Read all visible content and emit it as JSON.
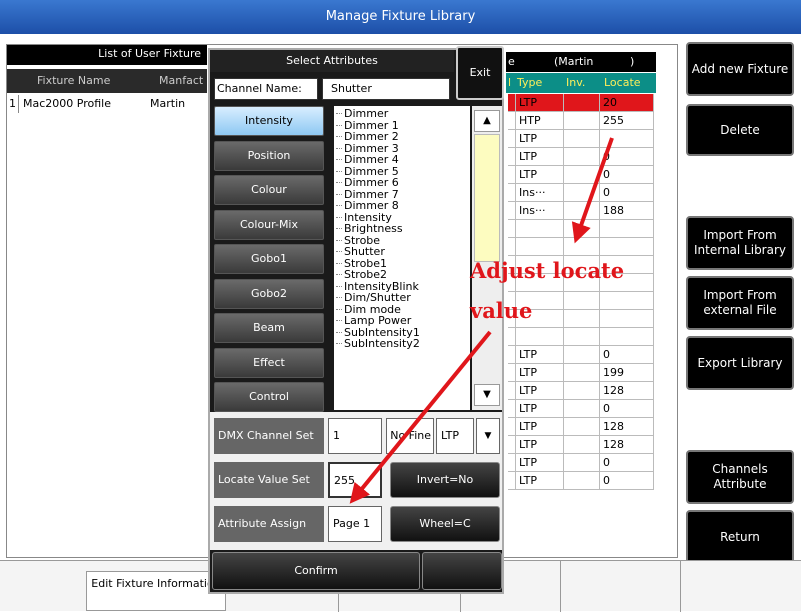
{
  "window": {
    "title": "Manage Fixture Library"
  },
  "left_panel": {
    "header": "List of User Fixture",
    "columns": [
      "Fixture Name",
      "Manfact"
    ],
    "rows": [
      {
        "index": "1",
        "name": "Mac2000 Profile",
        "manufacturer": "Martin"
      }
    ]
  },
  "channel_table": {
    "header_suffix": "e",
    "header_maker": "(Martin",
    "header_close": ")",
    "columns": [
      "l",
      "Type",
      "Inv.",
      "Locate"
    ],
    "rows": [
      {
        "type": "LTP",
        "inv": "",
        "locate": "20",
        "highlight": true
      },
      {
        "type": "HTP",
        "inv": "",
        "locate": "255"
      },
      {
        "type": "LTP",
        "inv": "",
        "locate": ""
      },
      {
        "type": "LTP",
        "inv": "",
        "locate": "0"
      },
      {
        "type": "LTP",
        "inv": "",
        "locate": "0"
      },
      {
        "type": "Ins···",
        "inv": "",
        "locate": "0"
      },
      {
        "type": "Ins···",
        "inv": "",
        "locate": "188"
      },
      {
        "type": "",
        "inv": "",
        "locate": ""
      },
      {
        "type": "",
        "inv": "",
        "locate": ""
      },
      {
        "type": "",
        "inv": "",
        "locate": ""
      },
      {
        "type": "",
        "inv": "",
        "locate": ""
      },
      {
        "type": "",
        "inv": "",
        "locate": ""
      },
      {
        "type": "",
        "inv": "",
        "locate": ""
      },
      {
        "type": "",
        "inv": "",
        "locate": ""
      },
      {
        "type": "LTP",
        "inv": "",
        "locate": "0"
      },
      {
        "type": "LTP",
        "inv": "",
        "locate": "199"
      },
      {
        "type": "LTP",
        "inv": "",
        "locate": "128"
      },
      {
        "type": "LTP",
        "inv": "",
        "locate": "0"
      },
      {
        "type": "LTP",
        "inv": "",
        "locate": "128"
      },
      {
        "type": "LTP",
        "inv": "",
        "locate": "128"
      },
      {
        "type": "LTP",
        "inv": "",
        "locate": "0"
      },
      {
        "type": "LTP",
        "inv": "",
        "locate": "0"
      }
    ]
  },
  "right_buttons": {
    "add_new": "Add new Fixture",
    "delete": "Delete",
    "import_internal": "Import From Internal Library",
    "import_external": "Import From external File",
    "export": "Export Library",
    "channels_attr": "Channels Attribute",
    "return": "Return"
  },
  "dialog": {
    "title": "Select Attributes",
    "exit": "Exit",
    "channel_name_label": "Channel Name:",
    "channel_name_value": "Shutter",
    "categories": [
      "Intensity",
      "Position",
      "Colour",
      "Colour-Mix",
      "Gobo1",
      "Gobo2",
      "Beam",
      "Effect",
      "Control"
    ],
    "selected_category": "Intensity",
    "attributes": [
      "Dimmer",
      "Dimmer 1",
      "Dimmer 2",
      "Dimmer 3",
      "Dimmer 4",
      "Dimmer 5",
      "Dimmer 6",
      "Dimmer 7",
      "Dimmer 8",
      "Intensity",
      "Brightness",
      "Strobe",
      "Shutter",
      "Strobe1",
      "Strobe2",
      "IntensityBlink",
      "Dim/Shutter",
      "Dim mode",
      "Lamp Power",
      "SubIntensity1",
      "SubIntensity2"
    ],
    "dmx_label": "DMX Channel Set",
    "dmx_value": "1",
    "fine_label": "No Fine",
    "ltp_value": "LTP",
    "locate_label": "Locate Value Set",
    "locate_value": "255",
    "invert_label": "Invert=No",
    "assign_label": "Attribute Assign",
    "assign_value": "Page 1",
    "wheel_label": "Wheel=C",
    "confirm": "Confirm"
  },
  "bottom": {
    "edit_info": "Edit Fixture Information"
  },
  "annotation": {
    "line1": "Adjust locate",
    "line2": "value",
    "color": "#e0161b"
  }
}
